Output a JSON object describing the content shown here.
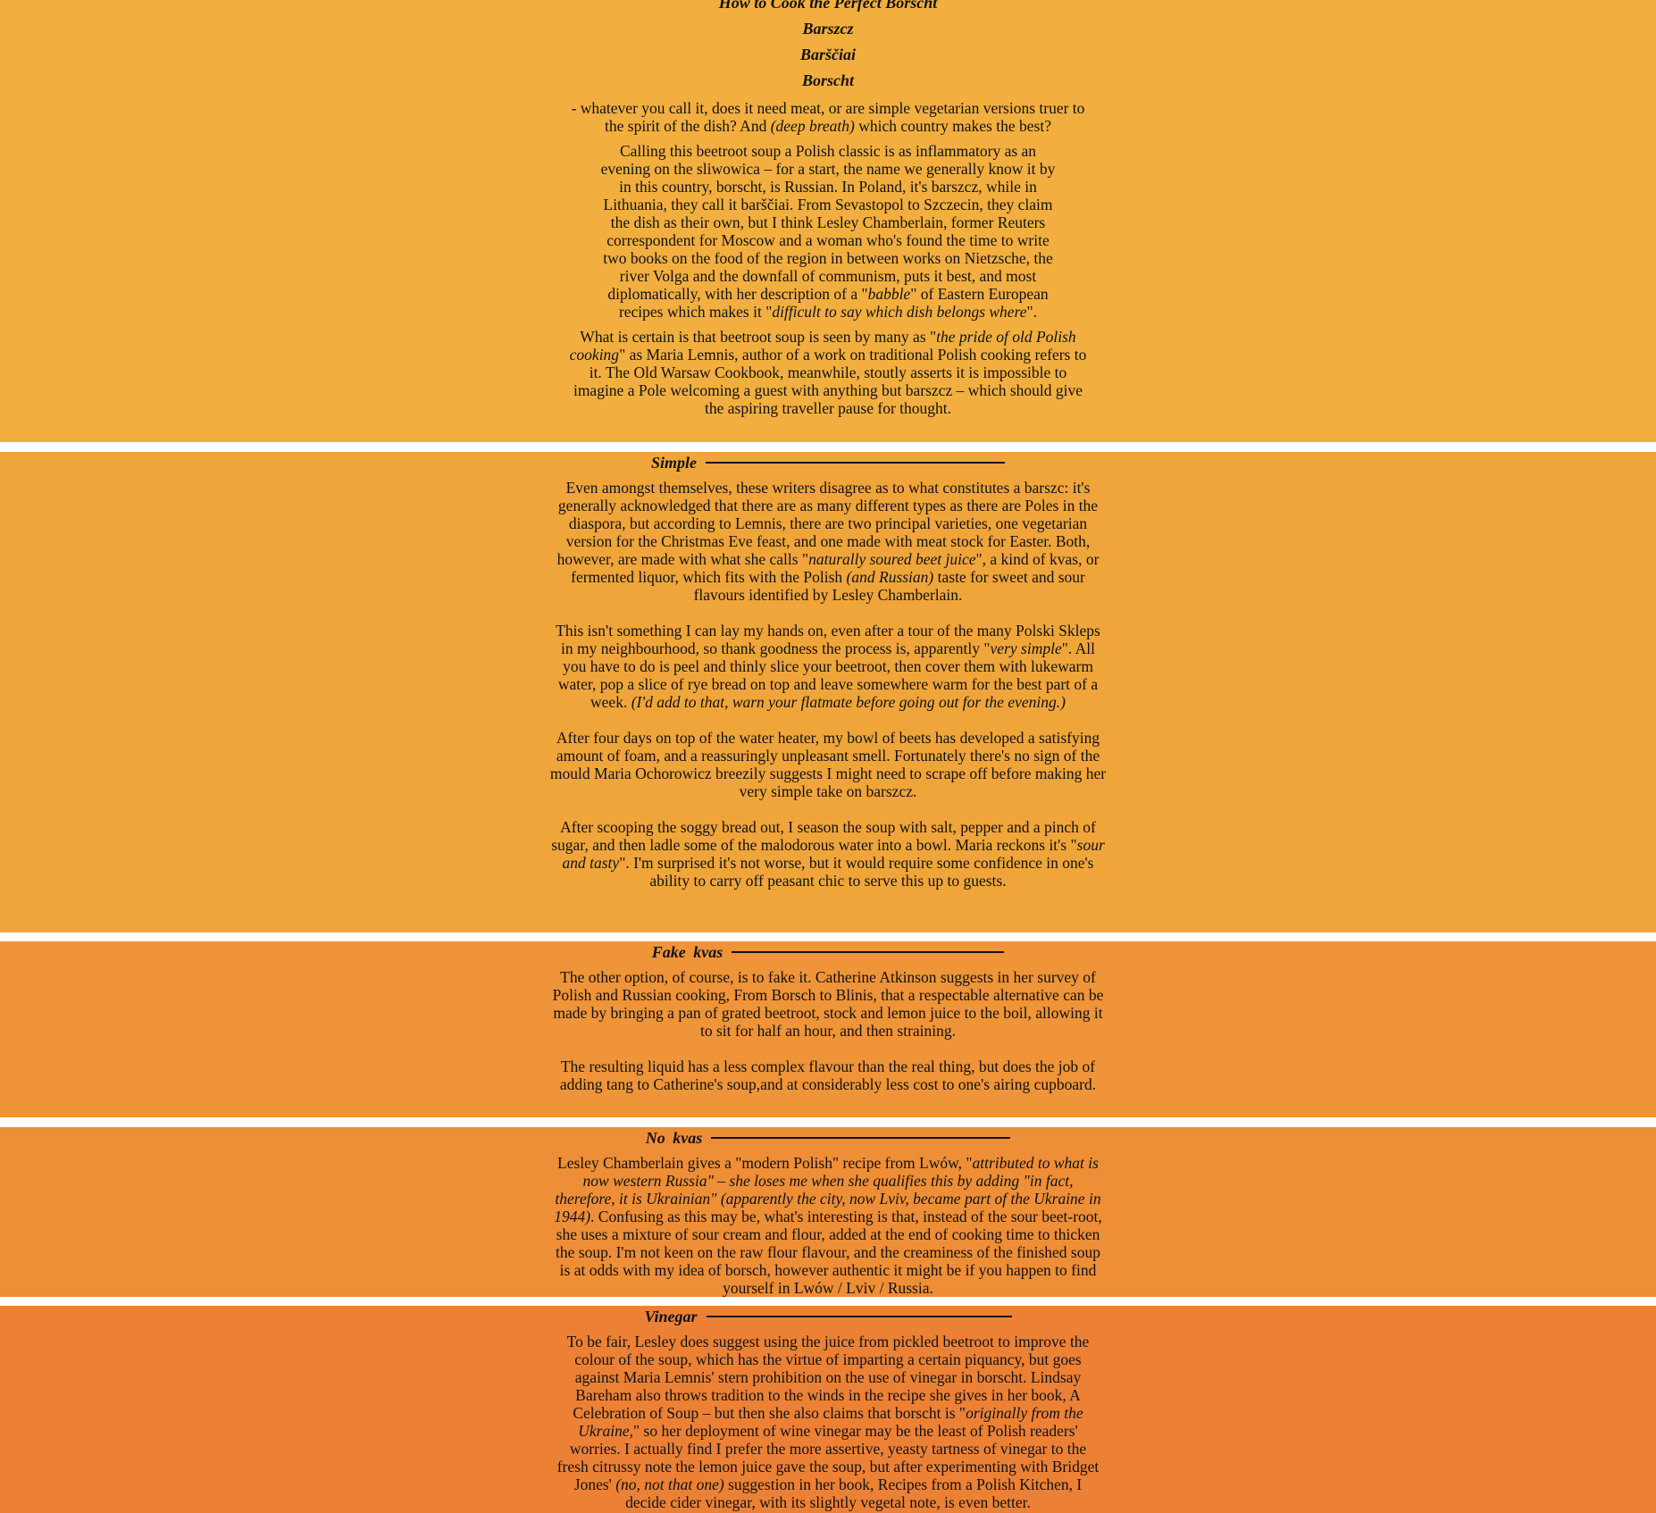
{
  "colors": {
    "band1": "#F2AF40",
    "band2": "#F0A53B",
    "band3": "#EF9438",
    "band4": "#EE8E37",
    "band5": "#EC8136",
    "divider": "#FFFFFF",
    "text": "#111111"
  },
  "intro": {
    "title": "How to Cook the Perfect Borscht",
    "names": [
      "Barszcz",
      "Barščiai",
      "Borscht"
    ],
    "lede_1": "- whatever you call it, does it need meat, or are simple vegetarian versions truer to the spirit of the dish? And ",
    "lede_em": "(deep breath)",
    "lede_2": " which country makes the best?",
    "p1_a": "Calling this beetroot soup a Polish classic is as inflammatory as an evening on the sliwowica – for a start, the name we generally know it by in this country, borscht, is Russian. In Poland, it's barszcz, while in Lithuania, they call it barščiai. From Sevastopol to Szczecin, they claim the dish as their own, but I think Lesley Chamberlain, former Reuters correspondent for Moscow and a woman who's found the time to write two books on the food of the region in between works on Nietzsche, the river Volga and the downfall of communism, puts it best, and most diplomatically, with her description of a \"",
    "p1_em1": "babble",
    "p1_b": "\" of Eastern European recipes which makes it \"",
    "p1_em2": "difficult to say which dish belongs where",
    "p1_c": "\".",
    "p2_a": "What is certain is that beetroot soup is seen by many as \"",
    "p2_em": "the pride of old Polish cooking",
    "p2_b": "\" as Maria Lemnis, author of a work on traditional Polish cooking refers to it. The Old Warsaw Cookbook, meanwhile, stoutly asserts it is impossible to imagine a Pole welcoming a guest with anything but barszcz – which should give the aspiring traveller pause for thought."
  },
  "simple": {
    "heading": "Simple",
    "p1_a": "Even amongst themselves, these writers disagree as to what constitutes a barszc: it's generally acknowledged that there are as many different types as there are Poles in the diaspora, but according to Lemnis, there are two principal varieties, one vegetarian version for the Christmas Eve feast, and one made with meat stock for Easter. Both, however, are made with what she calls \"",
    "p1_em1": "naturally soured beet juice",
    "p1_b": "\", a kind of kvas, or fermented liquor, which fits with the Polish ",
    "p1_em2": "(and Russian)",
    "p1_c": " taste for sweet and sour flavours identified by Lesley Chamberlain.",
    "p2_a": "This isn't something I can lay my hands on, even after a tour of the many Polski Skleps in my neighbourhood, so thank goodness the process is, apparently \"",
    "p2_em1": "very simple",
    "p2_b": "\". All you have to do is peel and thinly slice your beetroot, then cover them with lukewarm water, pop a slice of rye bread on top and leave somewhere warm for the best part of a week. ",
    "p2_em2": "(I'd add to that, warn your flatmate before going out for the evening.)",
    "p3": "After four days on top of the water heater, my bowl of beets has developed a satisfying amount of foam, and a reassuringly unpleasant smell. Fortunately there's no sign of the mould Maria Ochorowicz breezily suggests I might need to scrape off before making her very simple take on barszcz.",
    "p4_a": "After scooping the soggy bread out, I season the soup with salt, pepper and a pinch of sugar, and then ladle some of the malodorous water into a bowl. Maria reckons it's \"",
    "p4_em": "sour and tasty",
    "p4_b": "\". I'm surprised it's not worse, but it would require some confidence in one's ability to carry off peasant chic to serve this up to guests."
  },
  "fake_kvas": {
    "heading": "Fake kvas",
    "p1": "The other option, of course, is to fake it. Catherine Atkinson suggests in her survey of Polish and Russian cooking, From Borsch to Blinis, that a respectable alternative can be made by bringing a pan of grated beetroot, stock and lemon juice to the boil, allowing it to sit for half an hour, and then straining.",
    "p2": "The resulting liquid has a less complex flavour than the real thing, but does the job of adding tang to Catherine's soup,and at considerably less cost to one's airing cupboard."
  },
  "no_kvas": {
    "heading": "No kvas",
    "p1_a": "Lesley Chamberlain gives a \"modern Polish\" recipe from Lwów, \"",
    "p1_em": "attributed to what is now western Russia\" – she loses me when she qualifies this by adding \"in fact, therefore, it is Ukrainian\" (apparently the city, now Lviv, became part of the Ukraine in 1944)",
    "p1_b": ". Confusing as this may be, what's interesting is that, instead of the sour beet-root, she uses a mixture of sour cream and flour, added at the end of cooking time to thicken the soup. I'm not keen on the raw flour flavour, and the creaminess of the finished soup is at odds with my idea of borsch, however authentic it might be if you happen to find yourself in Lwów / Lviv / Russia."
  },
  "vinegar": {
    "heading": "Vinegar",
    "p1_a": "To be fair, Lesley does suggest using the juice from pickled beetroot to improve the colour of the soup, which has the virtue of imparting a certain piquancy, but goes against Maria Lemnis' stern prohibition on the use of vinegar in borscht. Lindsay Bareham also throws tradition to the winds in the recipe she gives in her book, A Celebration of Soup – but then she also claims that borscht is \"",
    "p1_em1": "originally from the Ukraine,",
    "p1_b": "\" so her deployment of wine vinegar may be the least of Polish readers' worries. I actually find I prefer the more assertive, yeasty tartness of vinegar to the fresh citrussy note the lemon juice gave the soup, but after experimenting with Bridget Jones' ",
    "p1_em2": "(no, not that one)",
    "p1_c": " suggestion in her book, Recipes from a Polish Kitchen, I decide cider vinegar, with its slightly vegetal note, is even better."
  }
}
